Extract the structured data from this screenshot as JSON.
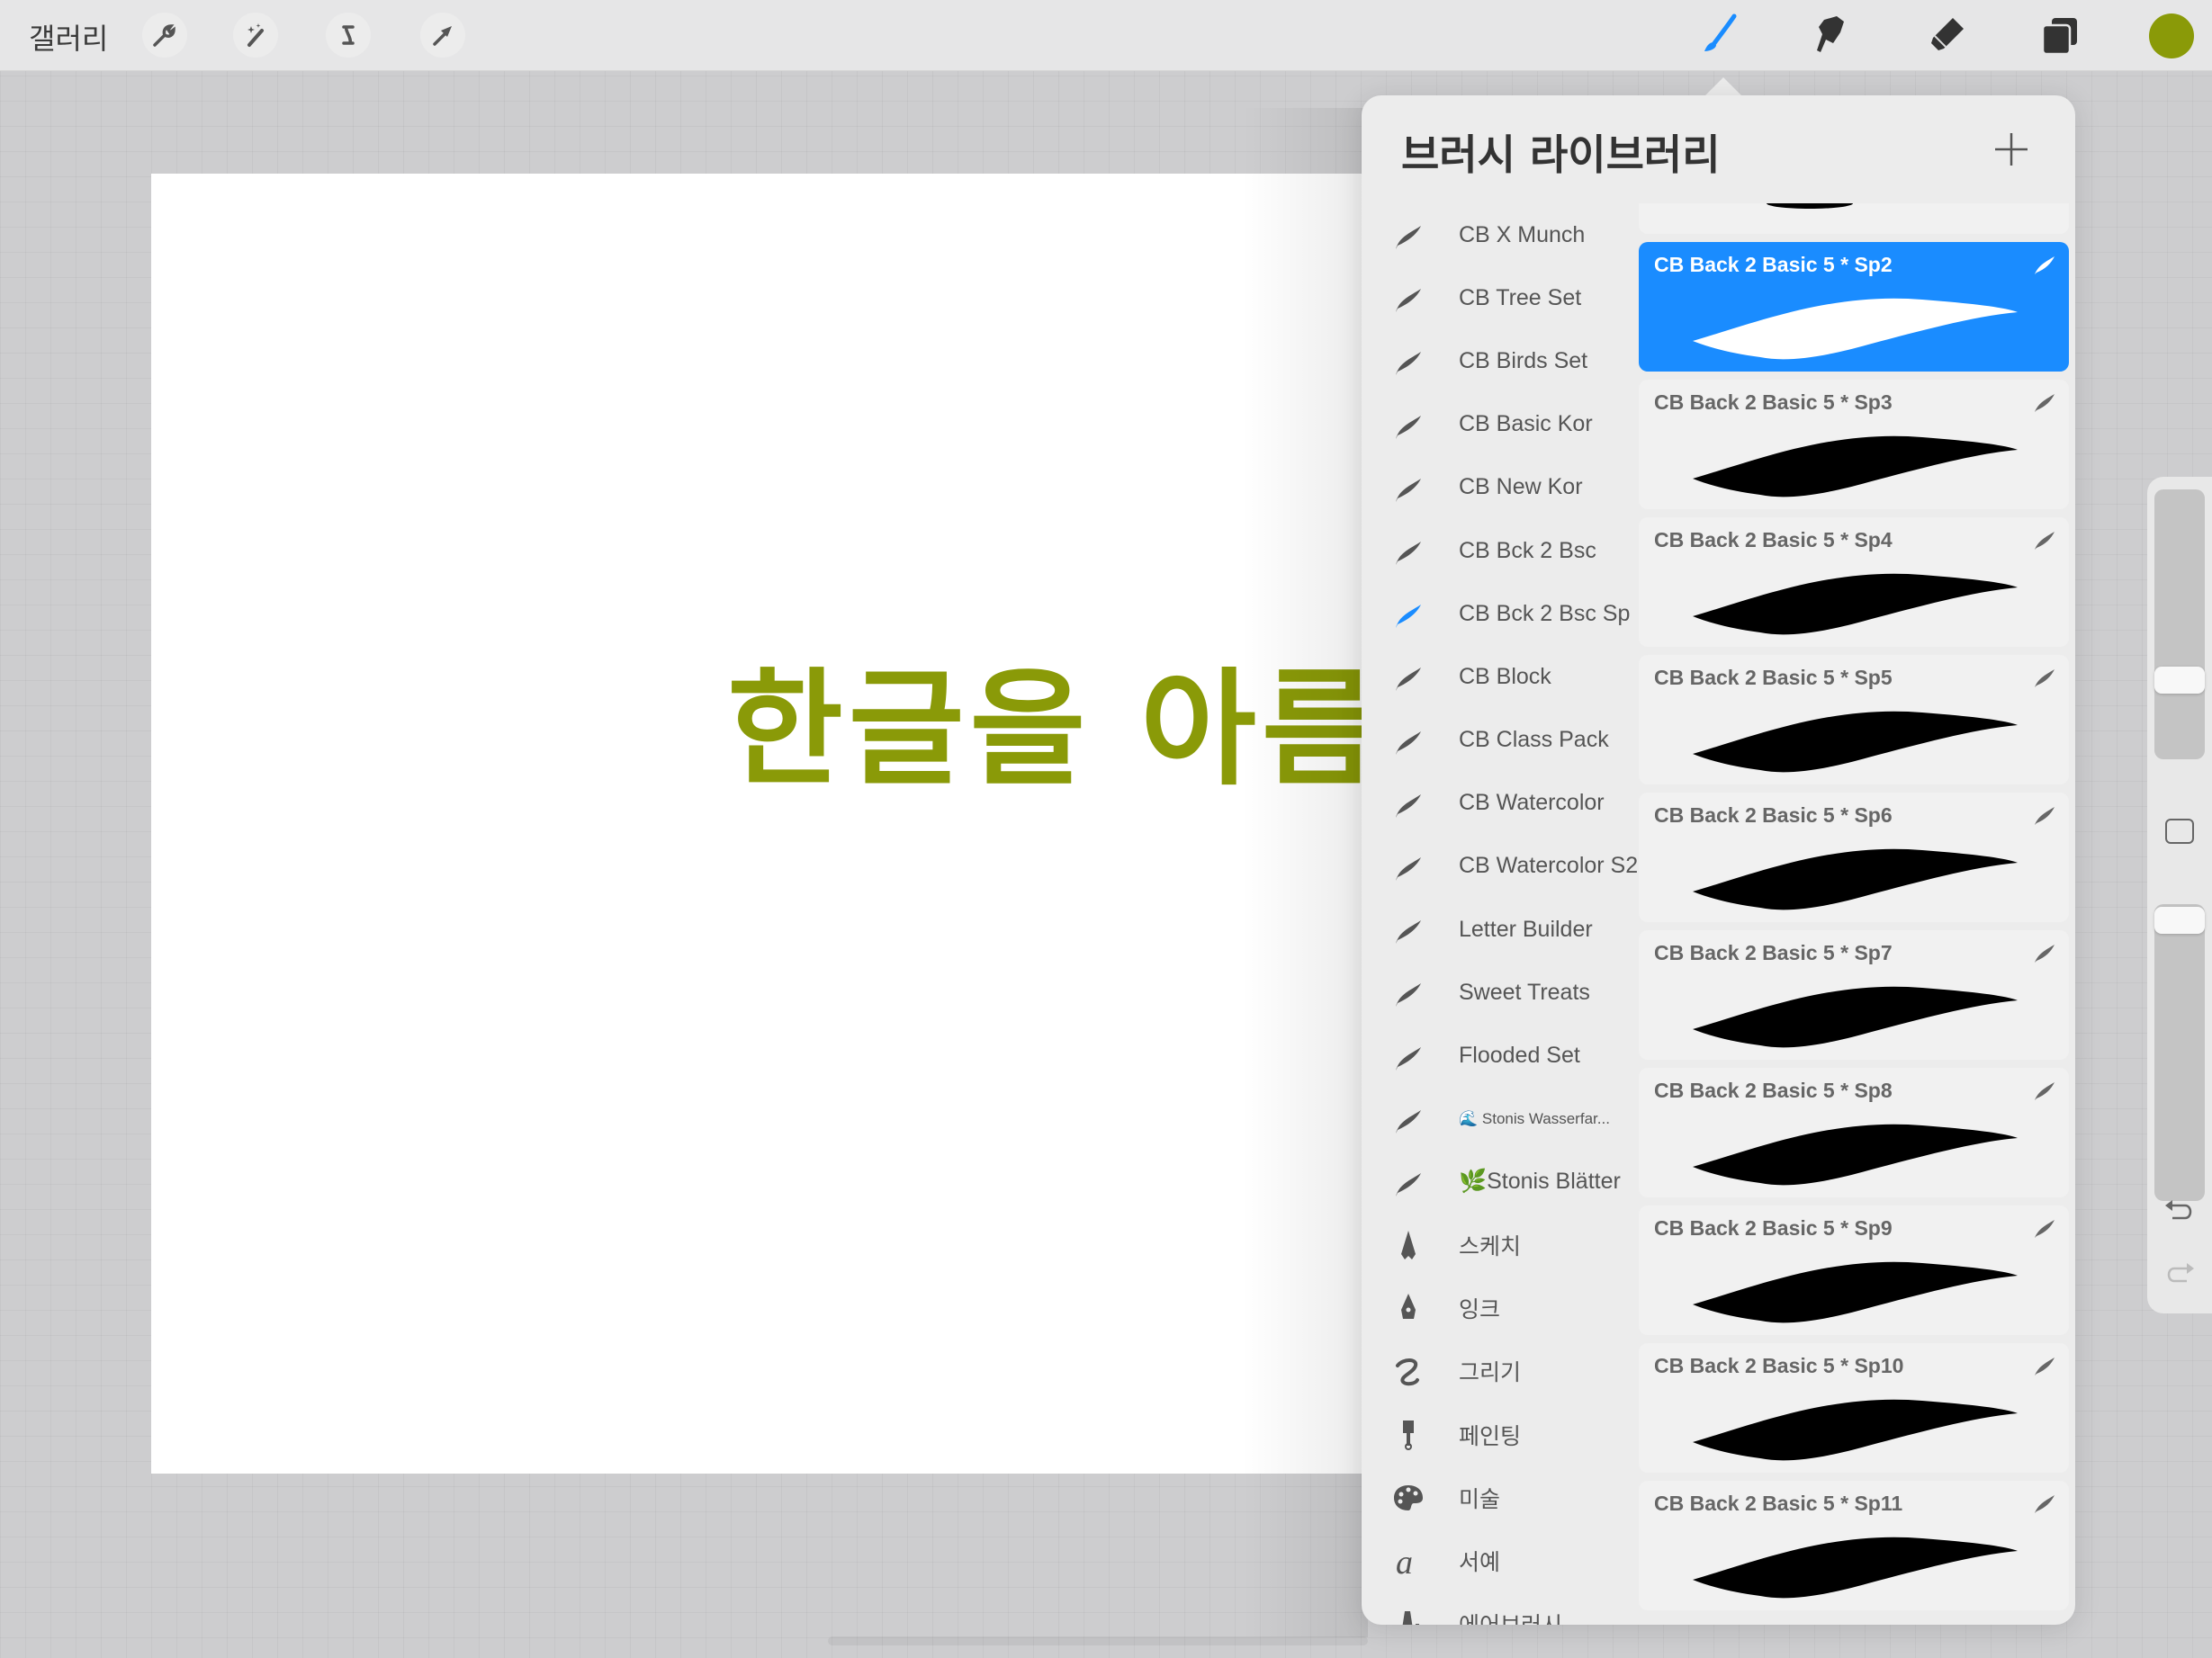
{
  "toolbar": {
    "gallery_label": "갤러리",
    "left_tools": [
      {
        "icon": "wrench-icon",
        "name": "actions"
      },
      {
        "icon": "magic-wand-icon",
        "name": "adjustments"
      },
      {
        "icon": "selection-icon",
        "name": "selection"
      },
      {
        "icon": "arrow-icon",
        "name": "transform"
      }
    ],
    "right_tools": [
      {
        "icon": "brush-icon",
        "name": "paint",
        "active": true
      },
      {
        "icon": "smudge-icon",
        "name": "smudge",
        "active": false
      },
      {
        "icon": "eraser-icon",
        "name": "erase",
        "active": false
      },
      {
        "icon": "layers-icon",
        "name": "layers",
        "active": false
      }
    ],
    "current_color": "#8a9a08",
    "active_color": "#1a8cff"
  },
  "canvas": {
    "text": "한글을 아름답게",
    "text_color": "#8a9a08"
  },
  "brush_library": {
    "title": "브러시 라이브러리",
    "add_label": "+",
    "sets": [
      {
        "label": "CB X Munch",
        "icon": "brush-set-icon"
      },
      {
        "label": "CB Tree Set",
        "icon": "brush-set-icon"
      },
      {
        "label": "CB Birds Set",
        "icon": "brush-set-icon"
      },
      {
        "label": "CB Basic Kor",
        "icon": "brush-set-icon"
      },
      {
        "label": "CB New Kor",
        "icon": "brush-set-icon"
      },
      {
        "label": "CB Bck 2 Bsc",
        "icon": "brush-set-icon"
      },
      {
        "label": "CB Bck 2 Bsc Sp",
        "icon": "brush-set-icon",
        "active": true
      },
      {
        "label": "CB Block",
        "icon": "brush-set-icon"
      },
      {
        "label": "CB Class Pack",
        "icon": "brush-set-icon"
      },
      {
        "label": "CB Watercolor",
        "icon": "brush-set-icon"
      },
      {
        "label": "CB Watercolor S2",
        "icon": "brush-set-icon"
      },
      {
        "label": "Letter Builder",
        "icon": "brush-set-icon"
      },
      {
        "label": "Sweet Treats",
        "icon": "brush-set-icon"
      },
      {
        "label": "Flooded Set",
        "icon": "brush-set-icon"
      },
      {
        "label": "🌊 Stonis Wasserfar...",
        "icon": "brush-set-icon",
        "small": true
      },
      {
        "label": "🌿Stonis Blätter",
        "icon": "brush-set-icon"
      },
      {
        "label": "스케치",
        "icon": "pencil-icon"
      },
      {
        "label": "잉크",
        "icon": "pen-nib-icon"
      },
      {
        "label": "그리기",
        "icon": "squiggle-icon"
      },
      {
        "label": "페인팅",
        "icon": "paintbrush-icon"
      },
      {
        "label": "미술",
        "icon": "palette-icon"
      },
      {
        "label": "서예",
        "icon": "calligraphy-icon"
      },
      {
        "label": "에어브러시",
        "icon": "airbrush-icon"
      }
    ],
    "brushes": [
      {
        "name": "",
        "partial": true
      },
      {
        "name": "CB Back 2 Basic 5 * Sp2",
        "selected": true
      },
      {
        "name": "CB Back 2 Basic 5 * Sp3"
      },
      {
        "name": "CB Back 2 Basic 5 * Sp4"
      },
      {
        "name": "CB Back 2 Basic 5 * Sp5"
      },
      {
        "name": "CB Back 2 Basic 5 * Sp6"
      },
      {
        "name": "CB Back 2 Basic 5 * Sp7"
      },
      {
        "name": "CB Back 2 Basic 5 * Sp8"
      },
      {
        "name": "CB Back 2 Basic 5 * Sp9"
      },
      {
        "name": "CB Back 2 Basic 5 * Sp10"
      },
      {
        "name": "CB Back 2 Basic 5 * Sp11"
      }
    ]
  },
  "sidebar": {
    "brush_size": 0.27,
    "opacity": 0.99
  }
}
